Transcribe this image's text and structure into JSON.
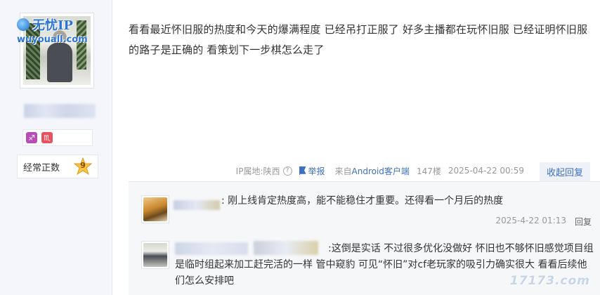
{
  "watermark": {
    "title": "无忧IP",
    "url": "wuyouall.com"
  },
  "user": {
    "level_label": "经常正数",
    "level_number": "9",
    "badges": [
      "♐",
      "♏"
    ]
  },
  "post": {
    "text": "看看最近怀旧服的热度和今天的爆满程度 已经吊打正服了 好多主播都在玩怀旧服 已经证明怀旧服的路子是正确的 看策划下一步棋怎么走了",
    "meta": {
      "ip": "IP属地:陕西",
      "help_icon": "?",
      "report_label": "举报",
      "client_prefix": "来自",
      "client_name": "Android客户端",
      "floor": "147楼",
      "date": "2025-04-22 00:59",
      "collapse_label": "收起回复"
    }
  },
  "replies": [
    {
      "text": ": 刚上线肯定热度高，能不能稳住才重要。还得看一个月后的热度",
      "date": "2025-4-22 01:13",
      "reply_label": "回复"
    },
    {
      "text": ":这倒是实话 不过很多优化没做好 怀旧也不够怀旧感觉项目组是临时组起来加工赶完活的一样 管中窥豹 可见“怀旧”对cf老玩家的吸引力确实很大 看看后续他们怎么安排吧"
    }
  ],
  "site_watermark": "17173.com",
  "colors": {
    "link": "#3d6fc2",
    "meta": "#999999",
    "sidebar_bg": "#f4f6fb"
  }
}
